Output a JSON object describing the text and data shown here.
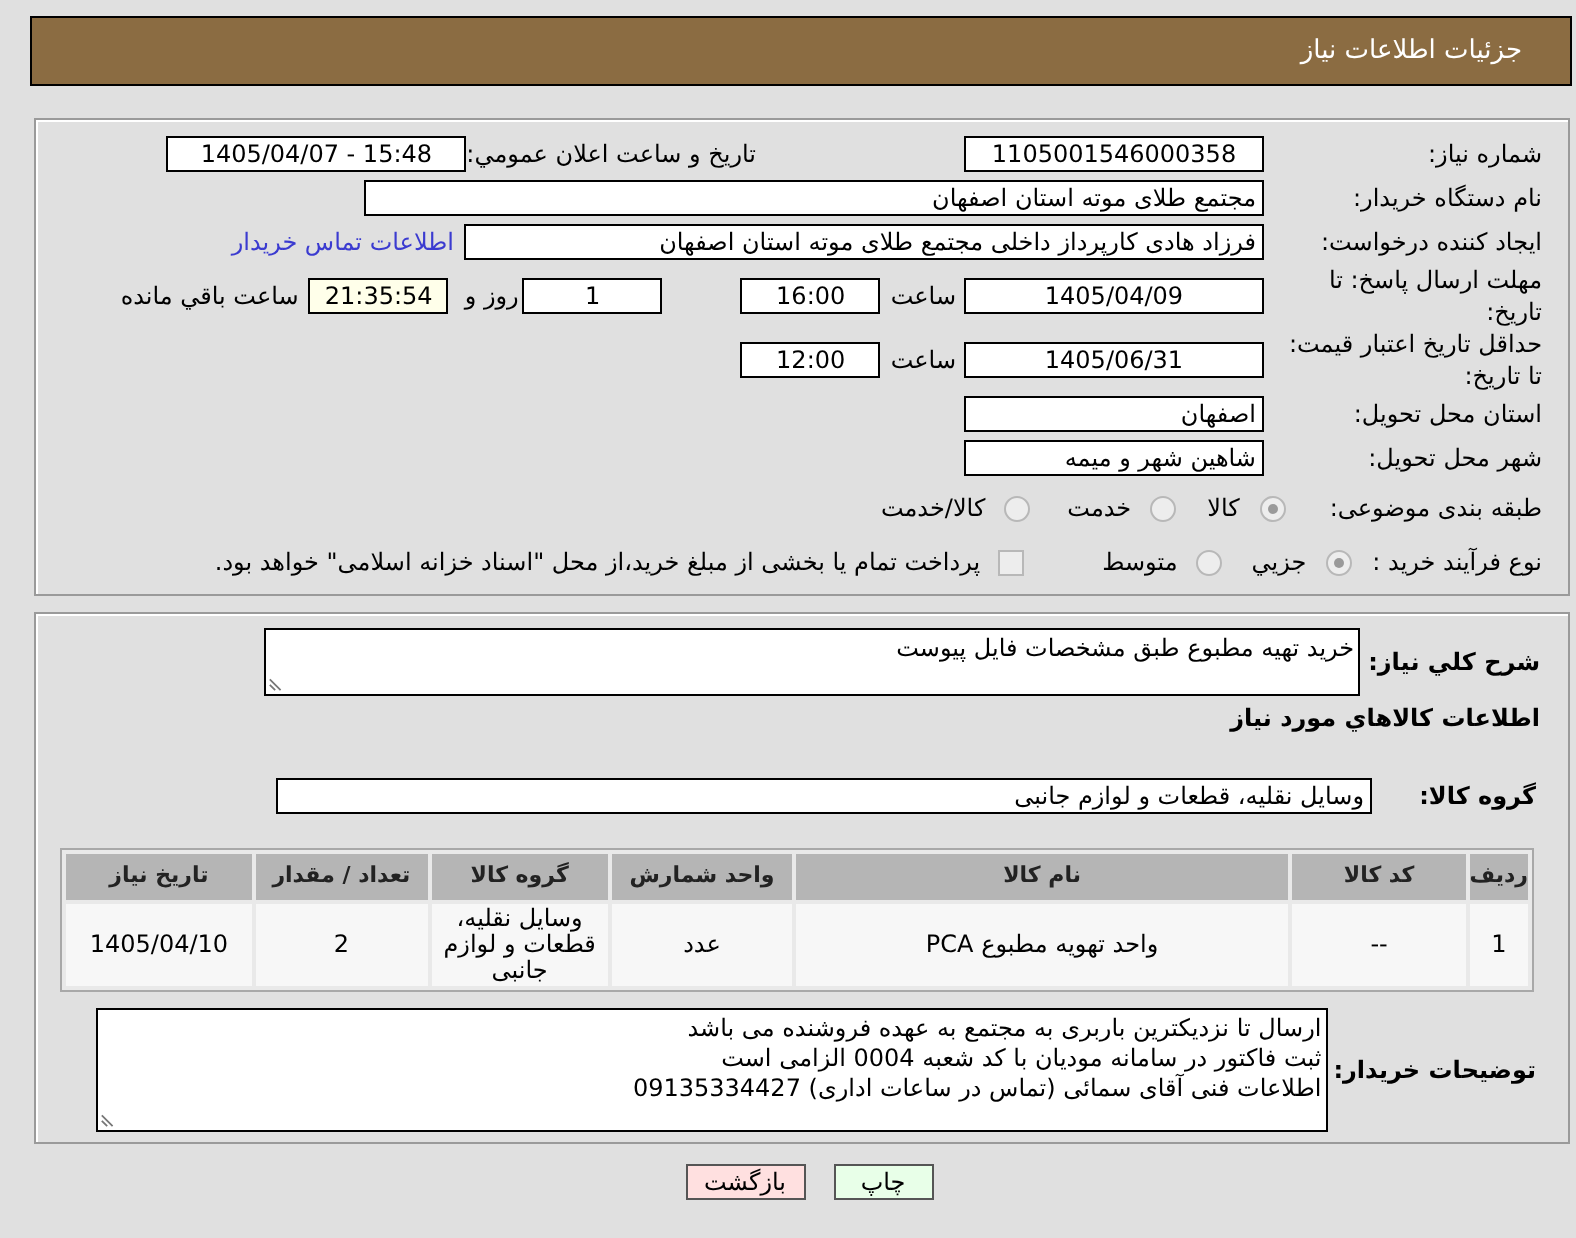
{
  "header": {
    "title": "جزئیات اطلاعات نیاز"
  },
  "need_info": {
    "need_number": {
      "label": "شماره نیاز:",
      "value": "1105001546000358"
    },
    "announcement": {
      "label": "تاریخ و ساعت اعلان عمومي:",
      "value": "1405/04/07 - 15:48"
    },
    "buyer_org": {
      "label": "نام دستگاه خریدار:",
      "value": "مجتمع طلای موته استان اصفهان"
    },
    "requester": {
      "label": "ایجاد کننده درخواست:",
      "value": "فرزاد هادی کارپرداز داخلی مجتمع طلای موته استان اصفهان",
      "link": "اطلاعات تماس خریدار"
    },
    "reply_deadline": {
      "label": "مهلت ارسال پاسخ: تا تاریخ:",
      "date": "1405/04/09",
      "time_label": "ساعت",
      "time": "16:00",
      "days": "1",
      "days_label": "روز و",
      "remaining": "21:35:54",
      "remaining_label": "ساعت باقي مانده"
    },
    "price_validity": {
      "label": "حداقل تاریخ اعتبار قیمت: تا تاریخ:",
      "date": "1405/06/31",
      "time_label": "ساعت",
      "time": "12:00"
    },
    "delivery_province": {
      "label": "استان محل تحویل:",
      "value": "اصفهان"
    },
    "delivery_city": {
      "label": "شهر محل تحویل:",
      "value": "شاهین شهر و میمه"
    },
    "category": {
      "label": "طبقه بندی موضوعی:",
      "options": [
        {
          "label": "کالا",
          "selected": true,
          "disabled": true
        },
        {
          "label": "خدمت",
          "selected": false,
          "disabled": true
        },
        {
          "label": "کالا/خدمت",
          "selected": false,
          "disabled": true
        }
      ]
    },
    "purchase_type": {
      "label": "نوع فرآیند خرید :",
      "options": [
        {
          "label": "جزيي",
          "selected": true,
          "disabled": true
        },
        {
          "label": "متوسط",
          "selected": false,
          "disabled": true
        }
      ],
      "treasury_payment": {
        "label": "پرداخت تمام یا بخشی از مبلغ خرید،از محل \"اسناد خزانه اسلامی\" خواهد بود.",
        "checked": false,
        "disabled": true
      }
    }
  },
  "items_info": {
    "description": {
      "label": "شرح کلي نیاز:",
      "value": "خرید تهیه مطبوع طبق مشخصات فایل پیوست"
    },
    "section_title": "اطلاعات کالاهاي مورد نیاز",
    "goods_group": {
      "label": "گروه کالا:",
      "value": "وسایل نقلیه، قطعات و لوازم جانبی"
    },
    "table": {
      "columns": [
        "ردیف",
        "کد کالا",
        "نام کالا",
        "واحد شمارش",
        "گروه کالا",
        "تعداد / مقدار",
        "تاریخ نیاز"
      ],
      "rows": [
        [
          "1",
          "--",
          "واحد تهویه مطبوع PCA",
          "عدد",
          "وسایل نقلیه، قطعات و لوازم جانبی",
          "2",
          "1405/04/10"
        ]
      ]
    },
    "buyer_notes": {
      "label": "توضیحات خریدار:",
      "lines": [
        "ارسال تا نزدیکترین باربری به مجتمع به عهده فروشنده می باشد",
        "ثبت فاکتور در سامانه مودیان با کد شعبه 0004 الزامی است",
        "اطلاعات فنی آقای سمائی (تماس در ساعات اداری) 09135334427"
      ]
    }
  },
  "buttons": [
    {
      "label": "چاپ",
      "kind": "print"
    },
    {
      "label": "بازگشت",
      "kind": "back"
    }
  ]
}
